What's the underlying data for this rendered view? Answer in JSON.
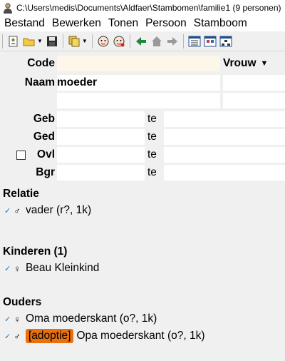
{
  "window": {
    "title": "C:\\Users\\medis\\Documents\\Aldfaer\\Stambomen\\familie1 (9 personen)",
    "app_icon": "person-icon"
  },
  "menu": {
    "items": [
      "Bestand",
      "Bewerken",
      "Tonen",
      "Persoon",
      "Stamboom"
    ]
  },
  "toolbar": {
    "icons": [
      "add-person-icon",
      "open-folder-icon",
      "save-icon",
      "copy-icon",
      "man-face-icon",
      "woman-face-icon",
      "arrow-left-icon",
      "home-icon",
      "arrow-right-icon",
      "view-list-icon",
      "view-card-icon",
      "view-tree-icon"
    ]
  },
  "person": {
    "code_label": "Code",
    "code_value": "",
    "gender": "Vrouw",
    "naam_label": "Naam",
    "naam_value": "moeder",
    "events": [
      {
        "label": "Geb",
        "te": "te",
        "value": "",
        "place": ""
      },
      {
        "label": "Ged",
        "te": "te",
        "value": "",
        "place": ""
      },
      {
        "label": "Ovl",
        "te": "te",
        "value": "",
        "place": "",
        "checked": false
      },
      {
        "label": "Bgr",
        "te": "te",
        "value": "",
        "place": ""
      }
    ]
  },
  "relatie": {
    "title": "Relatie",
    "items": [
      {
        "check": "✓",
        "symbol": "♂",
        "text": "vader (r?, 1k)"
      }
    ]
  },
  "kinderen": {
    "title": "Kinderen (1)",
    "items": [
      {
        "check": "✓",
        "symbol": "♀",
        "text": "Beau Kleinkind"
      }
    ]
  },
  "ouders": {
    "title": "Ouders",
    "items": [
      {
        "check": "✓",
        "symbol": "♀",
        "badge": "",
        "text": "Oma moederskant (o?, 1k)"
      },
      {
        "check": "✓",
        "symbol": "♂",
        "badge": "[adoptie]",
        "text": "Opa moederskant (o?, 1k)"
      }
    ]
  },
  "colors": {
    "panel_bg": "#f0f0f0",
    "code_field_bg": "#fdf7e9",
    "badge_bg": "#e8700e",
    "check_color": "#1a7ab5"
  }
}
